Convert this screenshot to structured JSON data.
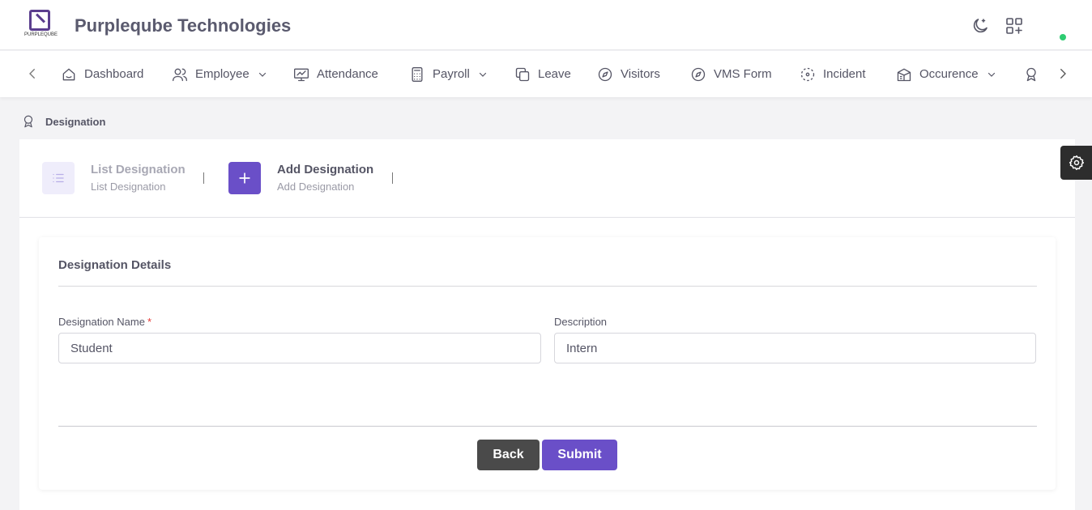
{
  "header": {
    "logo_text": "PURPLEQUBE",
    "company_name": "Purpleqube Technologies",
    "icons": [
      "moon-icon",
      "apps-add-icon"
    ],
    "status": "online"
  },
  "nav": {
    "items": [
      {
        "label": "Dashboard",
        "icon": "home-icon",
        "dropdown": false
      },
      {
        "label": "Employee",
        "icon": "users-icon",
        "dropdown": true
      },
      {
        "label": "Attendance",
        "icon": "monitor-chart-icon",
        "dropdown": false
      },
      {
        "label": "Payroll",
        "icon": "calculator-icon",
        "dropdown": true
      },
      {
        "label": "Leave",
        "icon": "copy-icon",
        "dropdown": false
      },
      {
        "label": "Visitors",
        "icon": "compass-icon",
        "dropdown": false
      },
      {
        "label": "VMS Form",
        "icon": "compass-icon",
        "dropdown": false
      },
      {
        "label": "Incident",
        "icon": "focus-icon",
        "dropdown": false
      },
      {
        "label": "Occurence",
        "icon": "building-icon",
        "dropdown": true
      }
    ]
  },
  "breadcrumb": {
    "label": "Designation"
  },
  "steps": [
    {
      "title": "List Designation",
      "subtitle": "List Designation",
      "active": false
    },
    {
      "title": "Add Designation",
      "subtitle": "Add Designation",
      "active": true
    }
  ],
  "form": {
    "section_title": "Designation Details",
    "fields": {
      "name": {
        "label": "Designation Name",
        "required_mark": "*",
        "value": "Student"
      },
      "description": {
        "label": "Description",
        "value": "Intern"
      }
    },
    "back_label": "Back",
    "submit_label": "Submit"
  },
  "colors": {
    "accent": "#6a4fc8",
    "brand": "#5b3e8e",
    "online": "#2ecc71"
  }
}
